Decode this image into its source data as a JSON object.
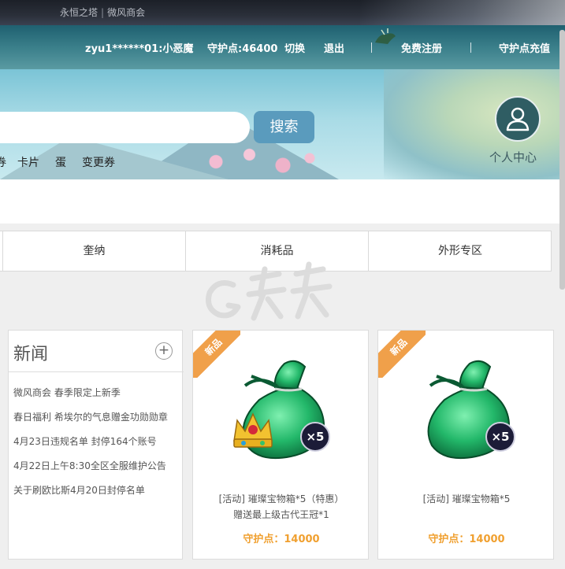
{
  "top_links": [
    "永恒之塔",
    "微风商会"
  ],
  "user_bar": {
    "account": "zyu1******01:小恶魔",
    "points": "守护点:46400",
    "switch_label": "切换",
    "logout_label": "退出",
    "register_label": "免费注册",
    "recharge_label": "守护点充值"
  },
  "search": {
    "placeholder": "",
    "button_label": "搜索"
  },
  "quick_links": [
    "卡片",
    "蛋",
    "变更券"
  ],
  "quick_link_cut": "券",
  "user_center_label": "个人中心",
  "tabs": [
    "奎纳",
    "消耗品",
    "外形专区"
  ],
  "news": {
    "title": "新闻",
    "plus": "+",
    "items": [
      "微风商会 春季限定上新季",
      "春日福利 希埃尔的气息赠金功勋勋章",
      "4月23日违规名单 封停164个账号",
      "4月22日上午8:30全区全服维护公告",
      "关于刷欧比斯4月20日封停名单"
    ]
  },
  "products": [
    {
      "ribbon": "新品",
      "quantity": "×5",
      "name_line1": "[活动] 璀璨宝物箱*5（特惠）",
      "name_line2": "赠送最上级古代王冠*1",
      "price": "守护点：14000"
    },
    {
      "ribbon": "新品",
      "quantity": "×5",
      "name_line1": "[活动] 璀璨宝物箱*5",
      "price": "守护点：14000"
    }
  ],
  "colors": {
    "accent_price": "#f0a030",
    "search_button": "#5a9bbd",
    "ribbon": "#f0a04a"
  }
}
